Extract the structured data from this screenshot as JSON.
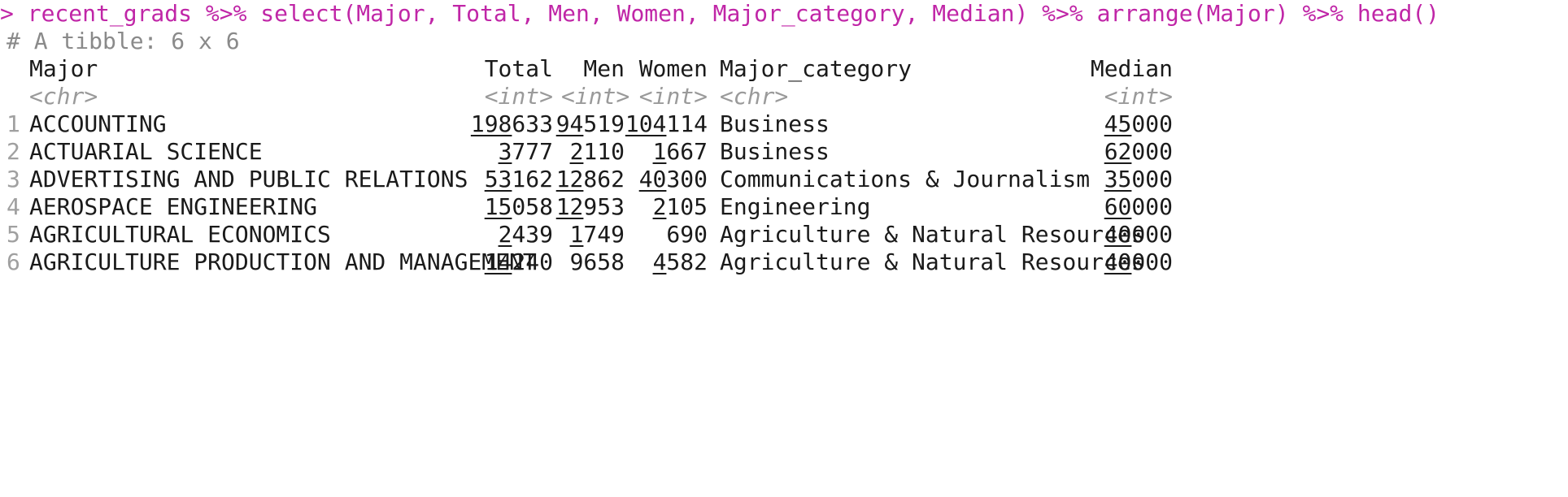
{
  "command": "> recent_grads %>% select(Major, Total, Men, Women, Major_category, Median) %>% arrange(Major) %>% head()",
  "tibble_comment": "# A tibble: 6 x 6",
  "columns": [
    "Major",
    "Total",
    "Men",
    "Women",
    "Major_category",
    "Median"
  ],
  "types": [
    "<chr>",
    "<int>",
    "<int>",
    "<int>",
    "<chr>",
    "<int>"
  ],
  "rows": [
    {
      "idx": "1",
      "major": "ACCOUNTING",
      "total_a": "198",
      "total_b": "633",
      "men_a": "94",
      "men_b": "519",
      "women_a": "104",
      "women_b": "114",
      "category": "Business",
      "median_a": "45",
      "median_b": "000"
    },
    {
      "idx": "2",
      "major": "ACTUARIAL SCIENCE",
      "total_a": "3",
      "total_b": "777",
      "men_a": "2",
      "men_b": "110",
      "women_a": "1",
      "women_b": "667",
      "category": "Business",
      "median_a": "62",
      "median_b": "000"
    },
    {
      "idx": "3",
      "major": "ADVERTISING AND PUBLIC RELATIONS",
      "total_a": "53",
      "total_b": "162",
      "men_a": "12",
      "men_b": "862",
      "women_a": "40",
      "women_b": "300",
      "category": "Communications & Journalism",
      "median_a": "35",
      "median_b": "000"
    },
    {
      "idx": "4",
      "major": "AEROSPACE ENGINEERING",
      "total_a": "15",
      "total_b": "058",
      "men_a": "12",
      "men_b": "953",
      "women_a": "2",
      "women_b": "105",
      "category": "Engineering",
      "median_a": "60",
      "median_b": "000"
    },
    {
      "idx": "5",
      "major": "AGRICULTURAL ECONOMICS",
      "total_a": "2",
      "total_b": "439",
      "men_a": "1",
      "men_b": "749",
      "women_a": "",
      "women_b": "690",
      "category": "Agriculture & Natural Resources",
      "median_a": "40",
      "median_b": "000"
    },
    {
      "idx": "6",
      "major": "AGRICULTURE PRODUCTION AND MANAGEMENT",
      "total_a": "14",
      "total_b": "240",
      "men_a": "",
      "men_b": "9658",
      "women_a": "4",
      "women_b": "582",
      "category": "Agriculture & Natural Resources",
      "median_a": "40",
      "median_b": "000"
    }
  ]
}
